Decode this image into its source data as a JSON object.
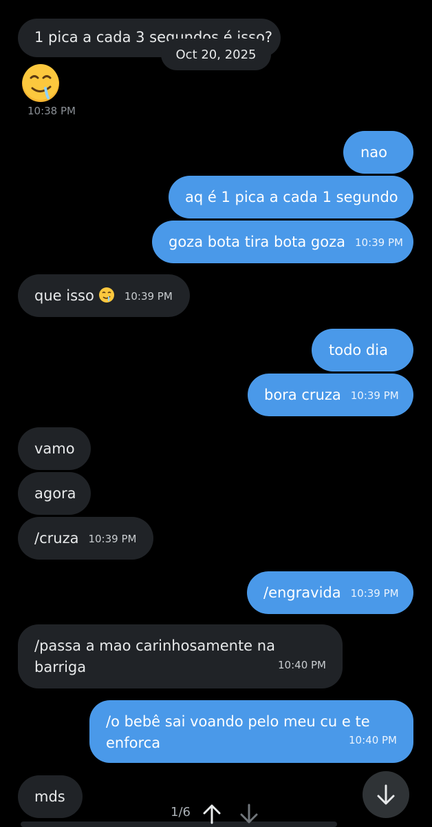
{
  "conversation": {
    "date_pill": "Oct 20, 2025",
    "first_message": "1 pica a cada 3 segundos é isso?",
    "emoji_caption_time": "10:38 PM",
    "messages": [
      {
        "text": "nao",
        "time": ""
      },
      {
        "text": "aq é 1 pica a cada 1 segundo",
        "time": ""
      },
      {
        "text": "goza bota tira bota goza",
        "time": "10:39 PM"
      },
      {
        "text": "que isso",
        "time": "10:39 PM"
      },
      {
        "text": "todo dia",
        "time": ""
      },
      {
        "text": "bora cruza",
        "time": "10:39 PM"
      },
      {
        "text": "vamo",
        "time": ""
      },
      {
        "text": "agora",
        "time": ""
      },
      {
        "text": "/cruza",
        "time": "10:39 PM"
      },
      {
        "text": "/engravida",
        "time": "10:39 PM"
      },
      {
        "text": "/passa a mao carinhosamente na barriga",
        "time": "10:40 PM"
      },
      {
        "text": "/o bebê sai voando pelo meu cu e te enforca",
        "time": "10:40 PM"
      },
      {
        "text": "mds",
        "time": ""
      }
    ]
  },
  "pager": {
    "label": "1/6"
  },
  "colors": {
    "background": "#000000",
    "incoming": "#202327",
    "outgoing": "#4a99e9"
  },
  "icons": [
    "drooling-face-emoji",
    "arrow-down-icon",
    "arrow-up-icon"
  ]
}
